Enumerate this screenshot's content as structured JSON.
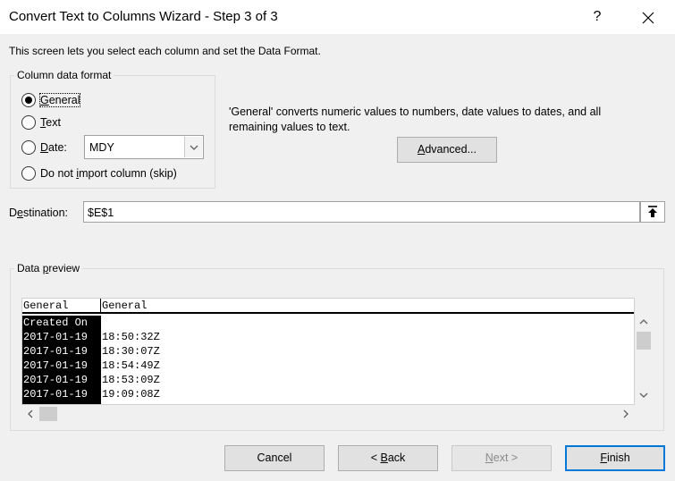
{
  "window": {
    "title": "Convert Text to Columns Wizard - Step 3 of 3",
    "help_label": "?",
    "close_label": "✕"
  },
  "intro": "This screen lets you select each column and set the Data Format.",
  "column_format": {
    "legend": "Column data format",
    "options": [
      {
        "label": "General",
        "access_key": "G",
        "checked": true
      },
      {
        "label": "Text",
        "access_key": "T",
        "checked": false
      },
      {
        "label": "Date:",
        "access_key": "D",
        "checked": false
      },
      {
        "label": "Do not import column (skip)",
        "access_key": "i",
        "checked": false
      }
    ],
    "date_format": "MDY"
  },
  "description": "'General' converts numeric values to numbers, date values to dates, and all remaining values to text.",
  "advanced_label": "Advanced...",
  "destination": {
    "label": "Destination:",
    "value": "$E$1"
  },
  "preview": {
    "legend": "Data preview",
    "headers": [
      "General",
      "General"
    ],
    "rows": [
      [
        "Created On",
        ""
      ],
      [
        "2017-01-19",
        "18:50:32Z"
      ],
      [
        "2017-01-19",
        "18:30:07Z"
      ],
      [
        "2017-01-19",
        "18:54:49Z"
      ],
      [
        "2017-01-19",
        "18:53:09Z"
      ],
      [
        "2017-01-19",
        "19:09:08Z"
      ]
    ]
  },
  "footer": {
    "cancel": "Cancel",
    "back": "< Back",
    "next": "Next >",
    "finish": "Finish"
  },
  "colors": {
    "accent": "#0078d7",
    "dialog_bg": "#f0f0f0"
  },
  "icons": {
    "close": "close-icon",
    "help": "help-icon",
    "dropdown": "chevron-down-icon",
    "collapse": "collapse-dialog-icon"
  }
}
